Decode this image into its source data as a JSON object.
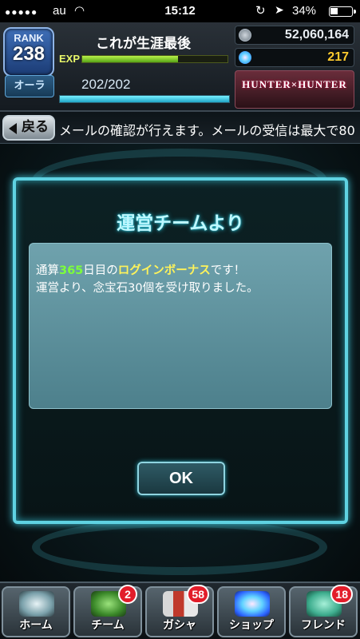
{
  "status_bar": {
    "signal": "●●●●●",
    "carrier": "au",
    "time": "15:12",
    "battery_percent": 34,
    "battery_text": "34%"
  },
  "header": {
    "rank_label": "RANK",
    "rank_value": "238",
    "player_name": "これが生涯最後",
    "exp_label": "EXP",
    "exp_fraction": 0.66,
    "aura_label": "オーラ",
    "aura_text": "202/202",
    "aura_fraction": 1.0,
    "coins": "52,060,164",
    "gems": "217",
    "game_logo": "HUNTER×HUNTER"
  },
  "ticker": {
    "back_label": "戻る",
    "message": "メールの確認が行えます。メールの受信は最大で80"
  },
  "dialog": {
    "title": "運営チームより",
    "line1_prefix": "通算",
    "line1_days": "365",
    "line1_mid": "日目の",
    "line1_bonus": "ログインボーナス",
    "line1_suffix": "です！",
    "line2": "運営より、念宝石30個を受け取りました。",
    "ok_label": "OK"
  },
  "bottom_nav": {
    "home": {
      "label": "ホーム",
      "icon": "home-icon"
    },
    "team": {
      "label": "チーム",
      "icon": "team-icon",
      "badge": "2"
    },
    "gacha": {
      "label": "ガシャ",
      "icon": "gacha-icon",
      "badge": "58"
    },
    "shop": {
      "label": "ショップ",
      "icon": "shop-icon"
    },
    "friend": {
      "label": "フレンド",
      "icon": "friend-icon",
      "badge": "18"
    }
  },
  "colors": {
    "accent": "#5fd2e2",
    "highlight_green": "#7dff3a",
    "highlight_yellow": "#fff35a",
    "badge_red": "#e21d2a"
  }
}
